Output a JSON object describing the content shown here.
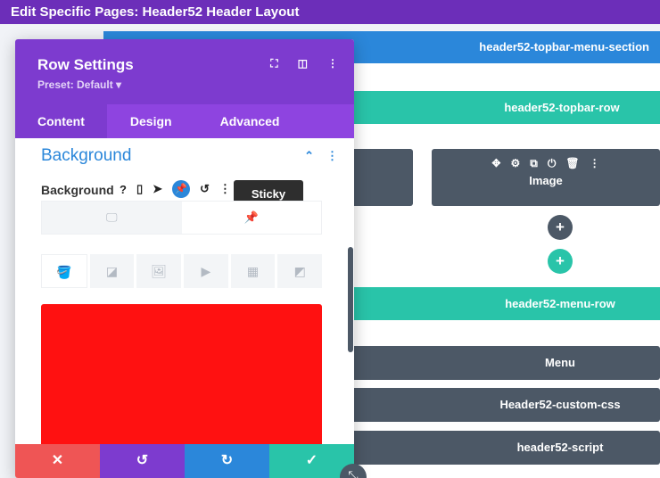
{
  "page_title": "Edit Specific Pages: Header52 Header Layout",
  "canvas": {
    "section_label": "header52-topbar-menu-section",
    "topbar_row_label": "header52-topbar-row",
    "image_module_label": "Image",
    "image_module_icons": [
      "move-icon",
      "gear-icon",
      "duplicate-icon",
      "power-icon",
      "trash-icon",
      "more-icon"
    ],
    "add_button_label": "+",
    "menu_row_label": "header52-menu-row",
    "menu_module_label": "Menu",
    "css_module_label": "Header52-custom-css",
    "script_module_label": "header52-script"
  },
  "modal": {
    "title": "Row Settings",
    "preset": "Preset: Default ▾",
    "tabs": [
      {
        "label": "Content",
        "active": true
      },
      {
        "label": "Design",
        "active": false
      },
      {
        "label": "Advanced",
        "active": false
      }
    ],
    "group_title": "Background",
    "field_label": "Background",
    "tooltip": "Sticky",
    "selected_color": "#ff1111",
    "footer": {
      "cancel_color": "#ef5555",
      "undo_color": "#7d3bcf",
      "redo_color": "#2b87da",
      "save_color": "#29c4a9"
    }
  },
  "colors": {
    "topbar": "#6c2eb9",
    "section": "#2b87da",
    "row": "#29c4a9",
    "module": "#4c5866"
  }
}
